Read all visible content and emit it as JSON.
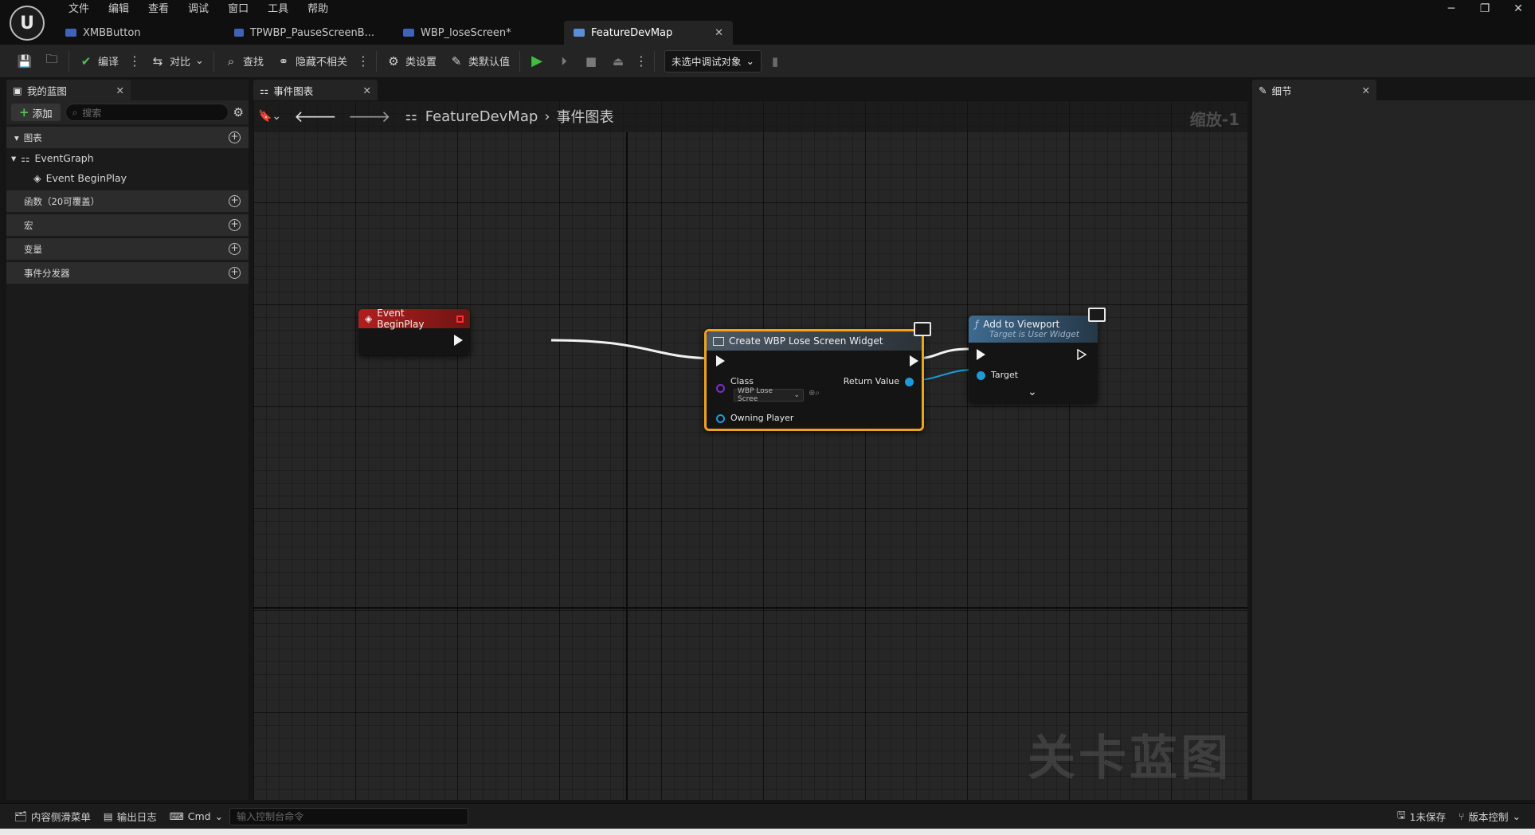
{
  "menu": [
    "文件",
    "编辑",
    "查看",
    "调试",
    "窗口",
    "工具",
    "帮助"
  ],
  "tabs": [
    {
      "label": "XMBButton",
      "color": "#3f63b8"
    },
    {
      "label": "TPWBP_PauseScreenB...",
      "color": "#3f63b8"
    },
    {
      "label": "WBP_loseScreen*",
      "color": "#3f63b8"
    },
    {
      "label": "FeatureDevMap",
      "color": "#5a8fd8"
    }
  ],
  "toolbar": {
    "compile": "编译",
    "diff": "对比",
    "find": "查找",
    "hide_unrelated": "隐藏不相关",
    "class_settings": "类设置",
    "class_defaults": "类默认值",
    "debug_target": "未选中调试对象"
  },
  "left_panel": {
    "tab": "我的蓝图",
    "add": "添加",
    "search_placeholder": "搜索",
    "section_graphs": "图表",
    "event_graph": "EventGraph",
    "event_beginplay": "Event BeginPlay",
    "section_functions": "函数（20可覆盖）",
    "section_macros": "宏",
    "section_variables": "变量",
    "section_dispatchers": "事件分发器"
  },
  "graph": {
    "tab": "事件图表",
    "crumb_root": "FeatureDevMap",
    "crumb_leaf": "事件图表",
    "zoom": "缩放-1",
    "watermark": "关卡蓝图"
  },
  "nodes": {
    "begin_play": {
      "title": "Event BeginPlay"
    },
    "create_widget": {
      "title": "Create WBP Lose Screen Widget",
      "class_label": "Class",
      "class_value": "WBP Lose Scree",
      "owning_player": "Owning Player",
      "return_value": "Return Value"
    },
    "add_viewport": {
      "title": "Add to Viewport",
      "subtitle": "Target is User Widget",
      "target": "Target"
    }
  },
  "right_panel": {
    "tab": "细节"
  },
  "status": {
    "content_drawer": "内容侧滑菜单",
    "output_log": "输出日志",
    "cmd": "Cmd",
    "cmd_placeholder": "输入控制台命令",
    "unsaved": "1未保存",
    "source_control": "版本控制"
  },
  "colors": {
    "event_red": "#9a1f1f",
    "create_gray": "#3b4652",
    "function_blue": "#35536d",
    "selection_orange": "#f0a21d",
    "object_pin_blue": "#1e9ad8",
    "class_pin_purple": "#7d2bd6"
  }
}
